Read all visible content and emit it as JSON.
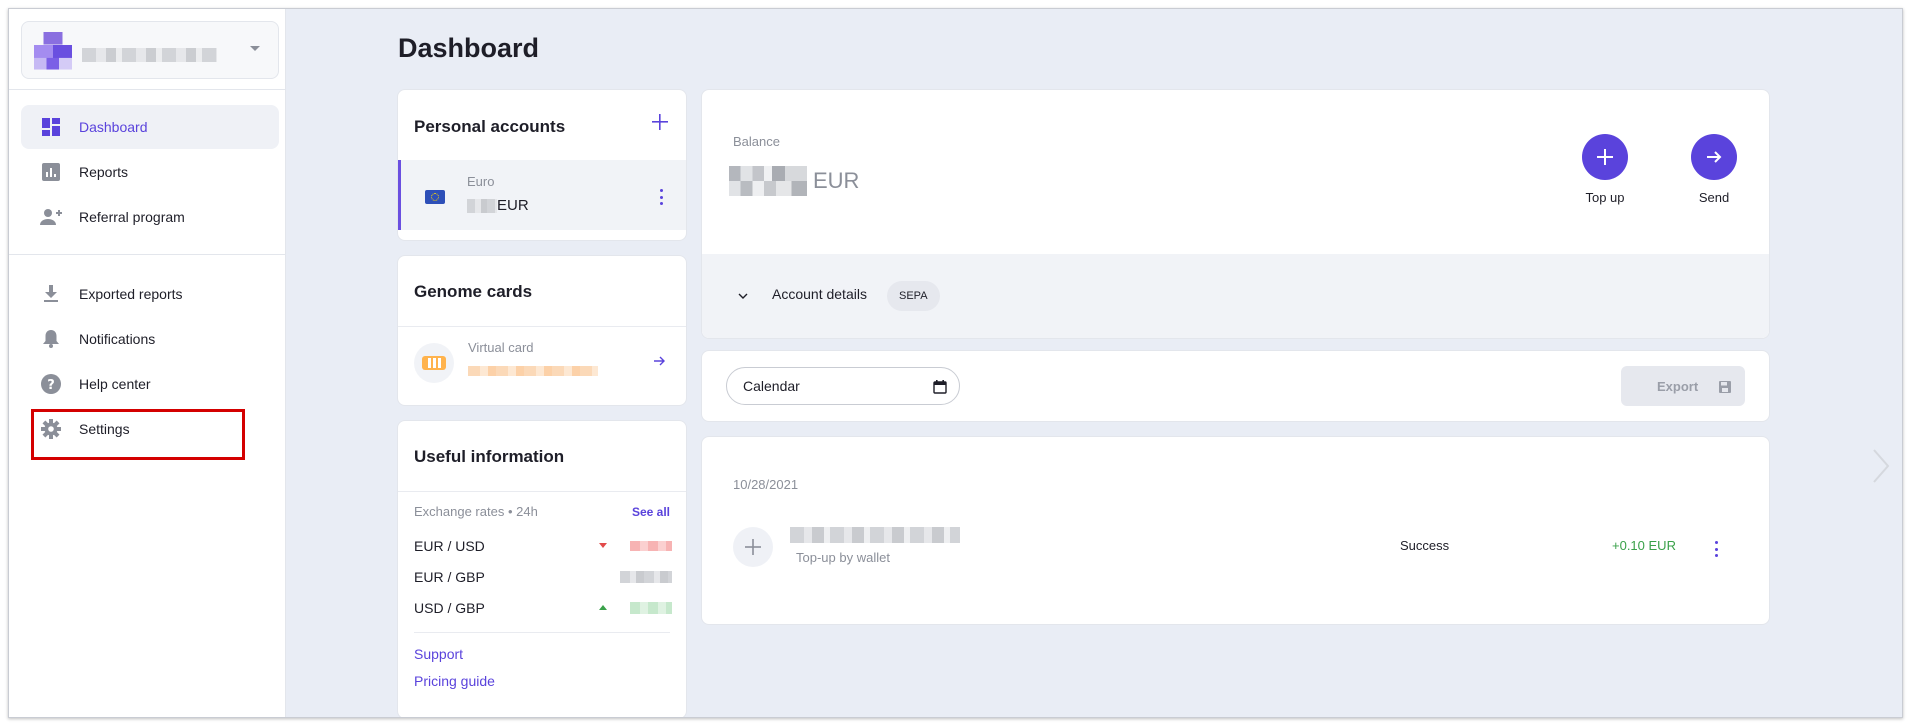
{
  "sidebar": {
    "items": [
      {
        "label": "Dashboard",
        "icon": "dashboard-icon"
      },
      {
        "label": "Reports",
        "icon": "reports-icon"
      },
      {
        "label": "Referral program",
        "icon": "add-person-icon"
      },
      {
        "label": "Exported reports",
        "icon": "download-icon"
      },
      {
        "label": "Notifications",
        "icon": "bell-icon"
      },
      {
        "label": "Help center",
        "icon": "help-icon"
      },
      {
        "label": "Settings",
        "icon": "gear-icon"
      }
    ]
  },
  "page": {
    "title": "Dashboard"
  },
  "personal_accounts": {
    "title": "Personal accounts",
    "account": {
      "name": "Euro",
      "currency": "EUR"
    }
  },
  "genome_cards": {
    "title": "Genome cards",
    "card": {
      "name": "Virtual card"
    }
  },
  "useful_info": {
    "title": "Useful information",
    "rates_label": "Exchange rates • 24h",
    "see_all": "See all",
    "rates": [
      {
        "pair": "EUR / USD",
        "trend": "down"
      },
      {
        "pair": "EUR / GBP",
        "trend": "none"
      },
      {
        "pair": "USD / GBP",
        "trend": "up"
      }
    ],
    "support": "Support",
    "pricing": "Pricing guide"
  },
  "balance": {
    "label": "Balance",
    "currency": "EUR",
    "top_up": "Top up",
    "send": "Send",
    "account_details": "Account details",
    "badge": "SEPA"
  },
  "filters": {
    "calendar": "Calendar",
    "export": "Export"
  },
  "transactions": {
    "date": "10/28/2021",
    "items": [
      {
        "description": "Top-up by wallet",
        "status": "Success",
        "amount": "+0.10 EUR"
      }
    ]
  },
  "colors": {
    "accent": "#5a43dc",
    "success": "#3aa14a",
    "down": "#e24a4a",
    "up": "#3aa14a",
    "highlight": "#d40000"
  }
}
